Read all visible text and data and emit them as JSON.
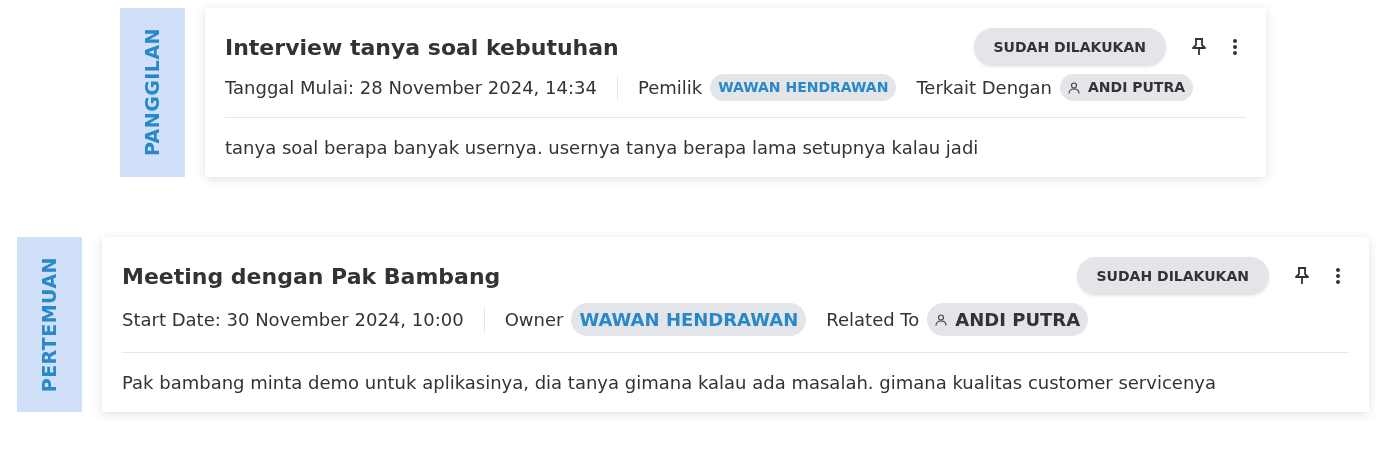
{
  "activities": [
    {
      "type_label": "PANGGILAN",
      "title": "Interview tanya soal kebutuhan",
      "status": "SUDAH DILAKUKAN",
      "date": "Tanggal Mulai: 28 November 2024, 14:34",
      "owner_label": "Pemilik",
      "owner": "WAWAN HENDRAWAN",
      "related_label": "Terkait Dengan",
      "related": "ANDI PUTRA",
      "description": "tanya soal berapa banyak usernya. usernya tanya berapa lama setupnya kalau jadi"
    },
    {
      "type_label": "PERTEMUAN",
      "title": "Meeting dengan Pak Bambang",
      "status": "SUDAH DILAKUKAN",
      "date": "Start Date: 30 November 2024, 10:00",
      "owner_label": "Owner",
      "owner": "WAWAN HENDRAWAN",
      "related_label": "Related To",
      "related": "ANDI PUTRA",
      "description": "Pak bambang minta demo untuk aplikasinya, dia tanya gimana kalau ada masalah. gimana kualitas customer servicenya"
    }
  ]
}
